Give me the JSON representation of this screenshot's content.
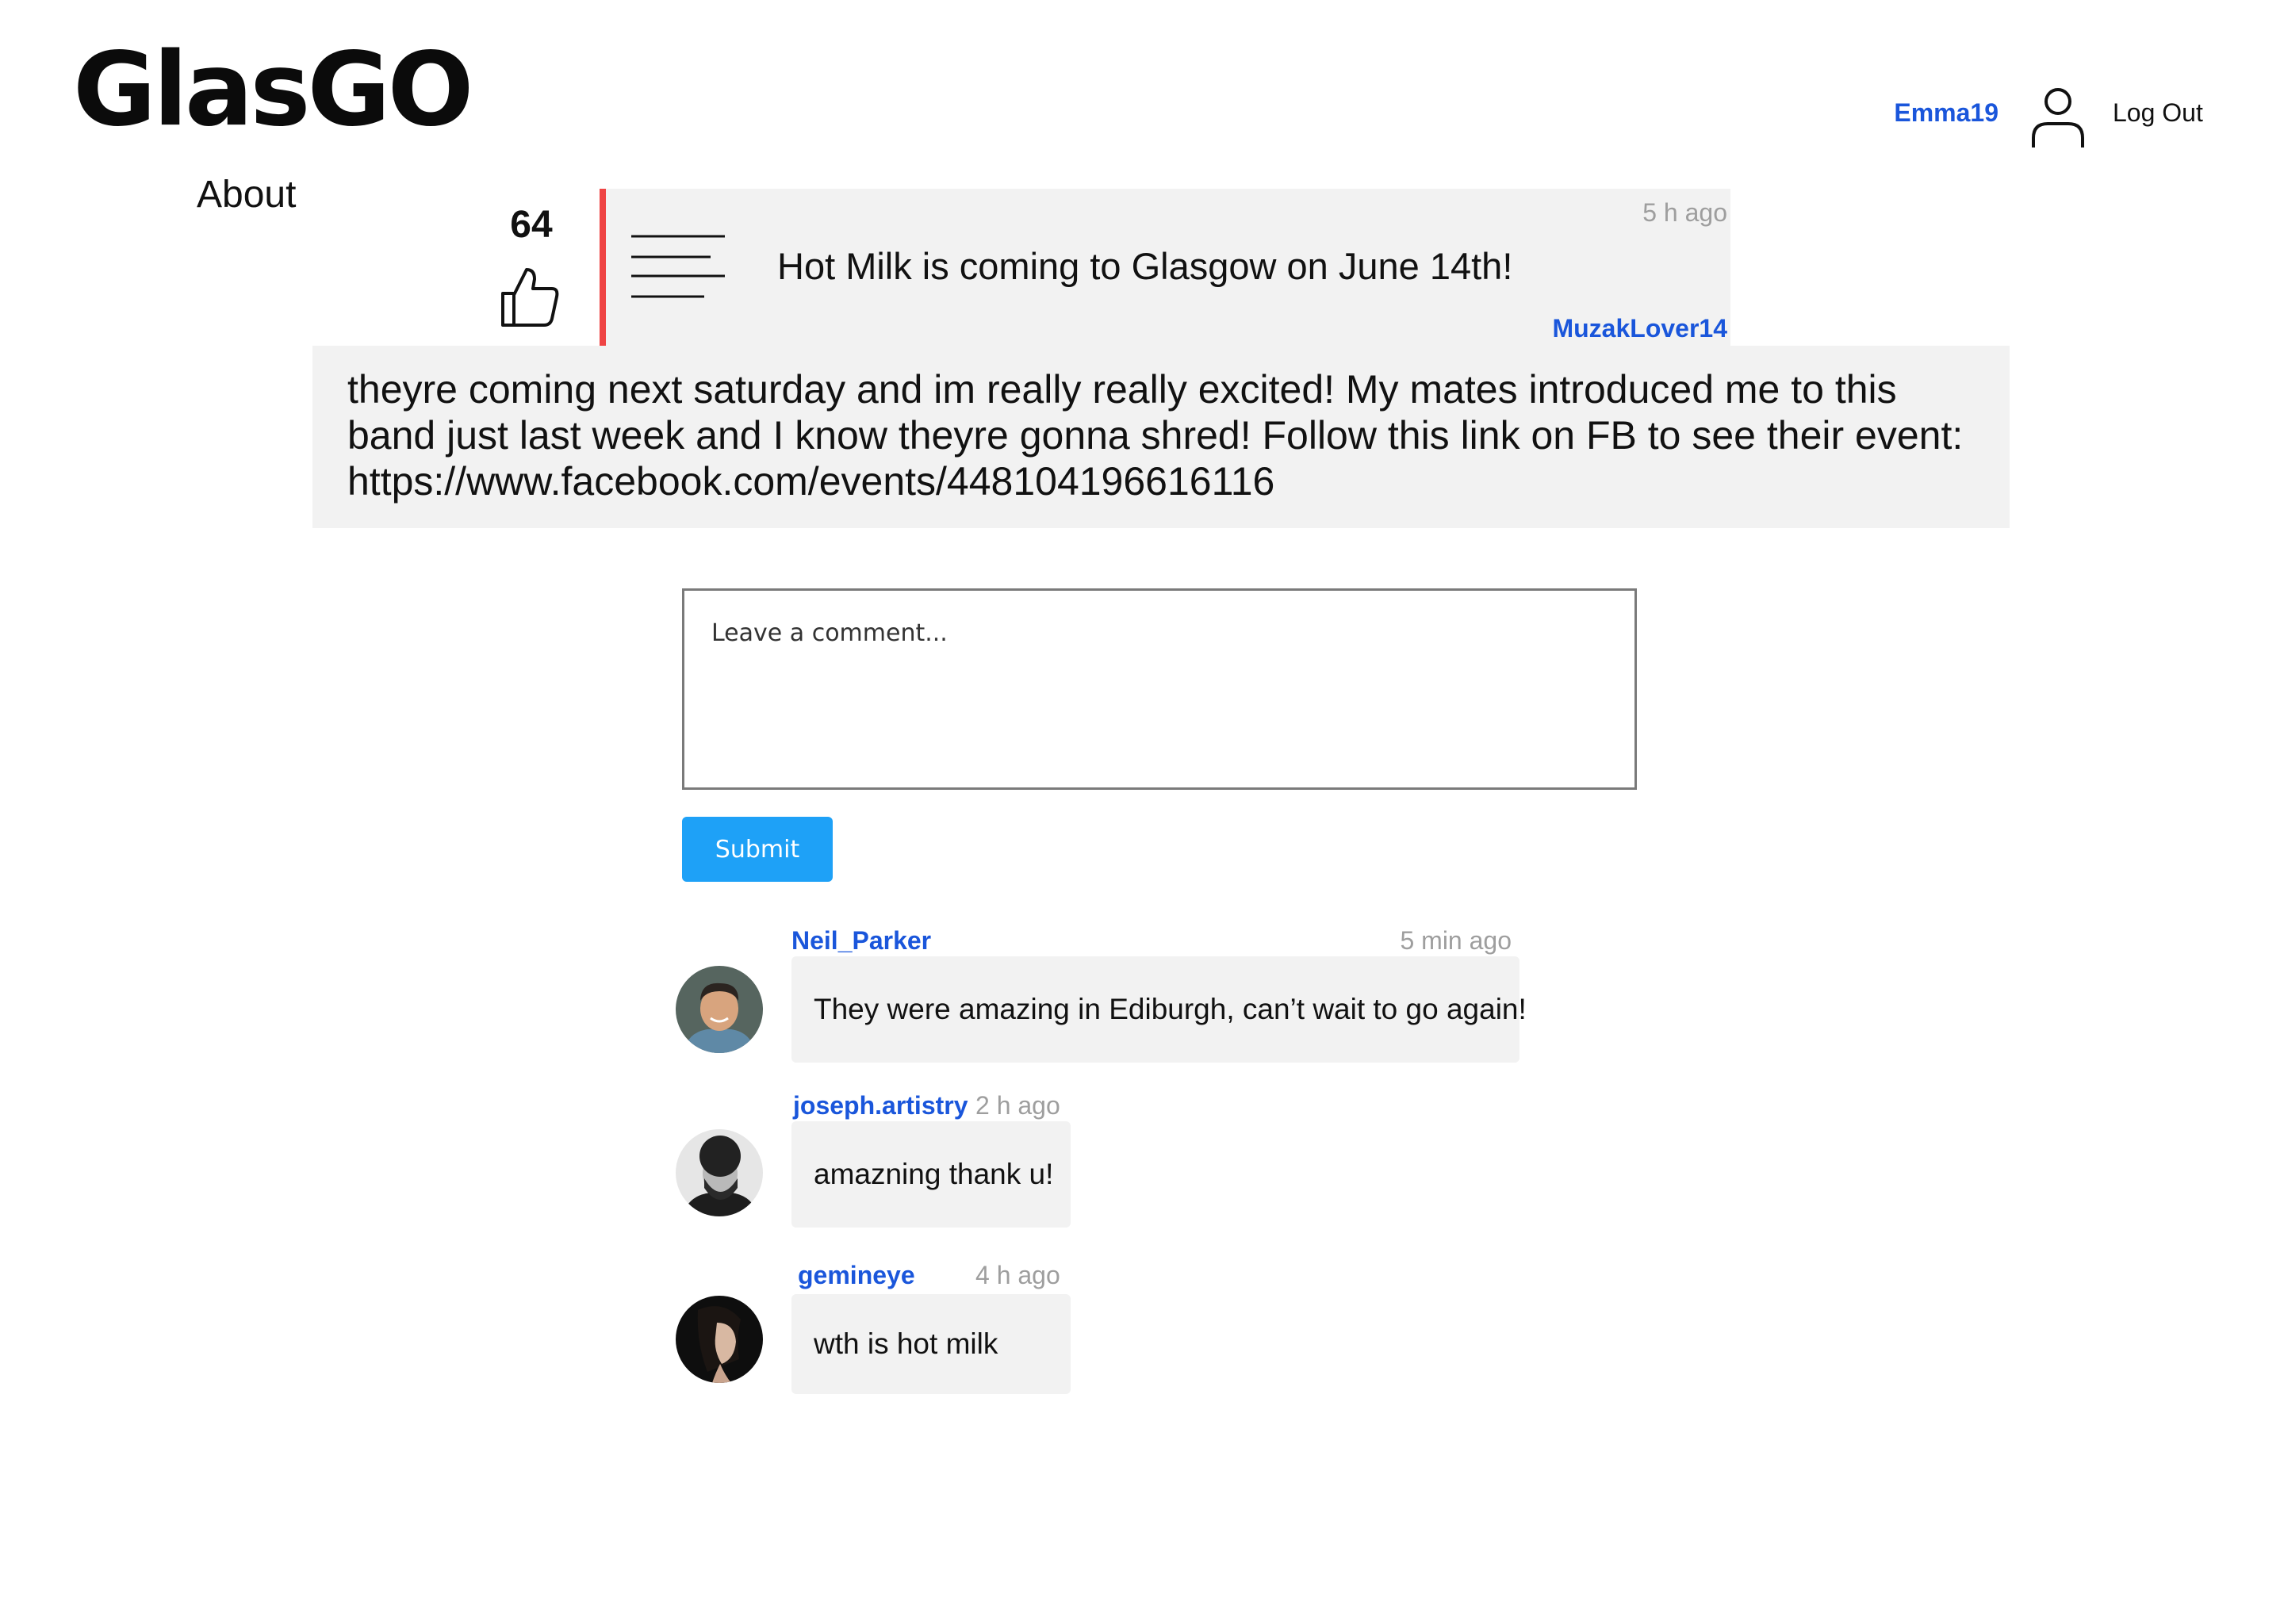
{
  "header": {
    "logo": "GlasGO",
    "username": "Emma19",
    "logout_label": "Log Out",
    "user_icon": "user-icon"
  },
  "nav": {
    "about_label": "About"
  },
  "post": {
    "votes": "64",
    "title": "Hot Milk is coming to Glasgow on June 14th!",
    "time": "5 h ago",
    "author": "MuzakLover14",
    "body": "theyre coming next saturday and im really really excited! My mates introduced me to this band just last week and I know theyre gonna shred! Follow this link on FB to see their event: https://www.facebook.com/events/448104196616116",
    "accent_color": "#ef4444"
  },
  "comment_form": {
    "placeholder": "Leave a comment...",
    "submit_label": "Submit"
  },
  "comments": [
    {
      "user": "Neil_Parker",
      "time": "5 min ago",
      "text": "They were amazing in Ediburgh, can’t wait to go again!"
    },
    {
      "user": "joseph.artistry",
      "time": "2 h ago",
      "text": "amazning thank u!"
    },
    {
      "user": "gemineye",
      "time": "4 h ago",
      "text": "wth is hot milk"
    }
  ],
  "colors": {
    "link": "#1a56db",
    "button": "#1ea1f7",
    "panel": "#f2f2f2"
  }
}
